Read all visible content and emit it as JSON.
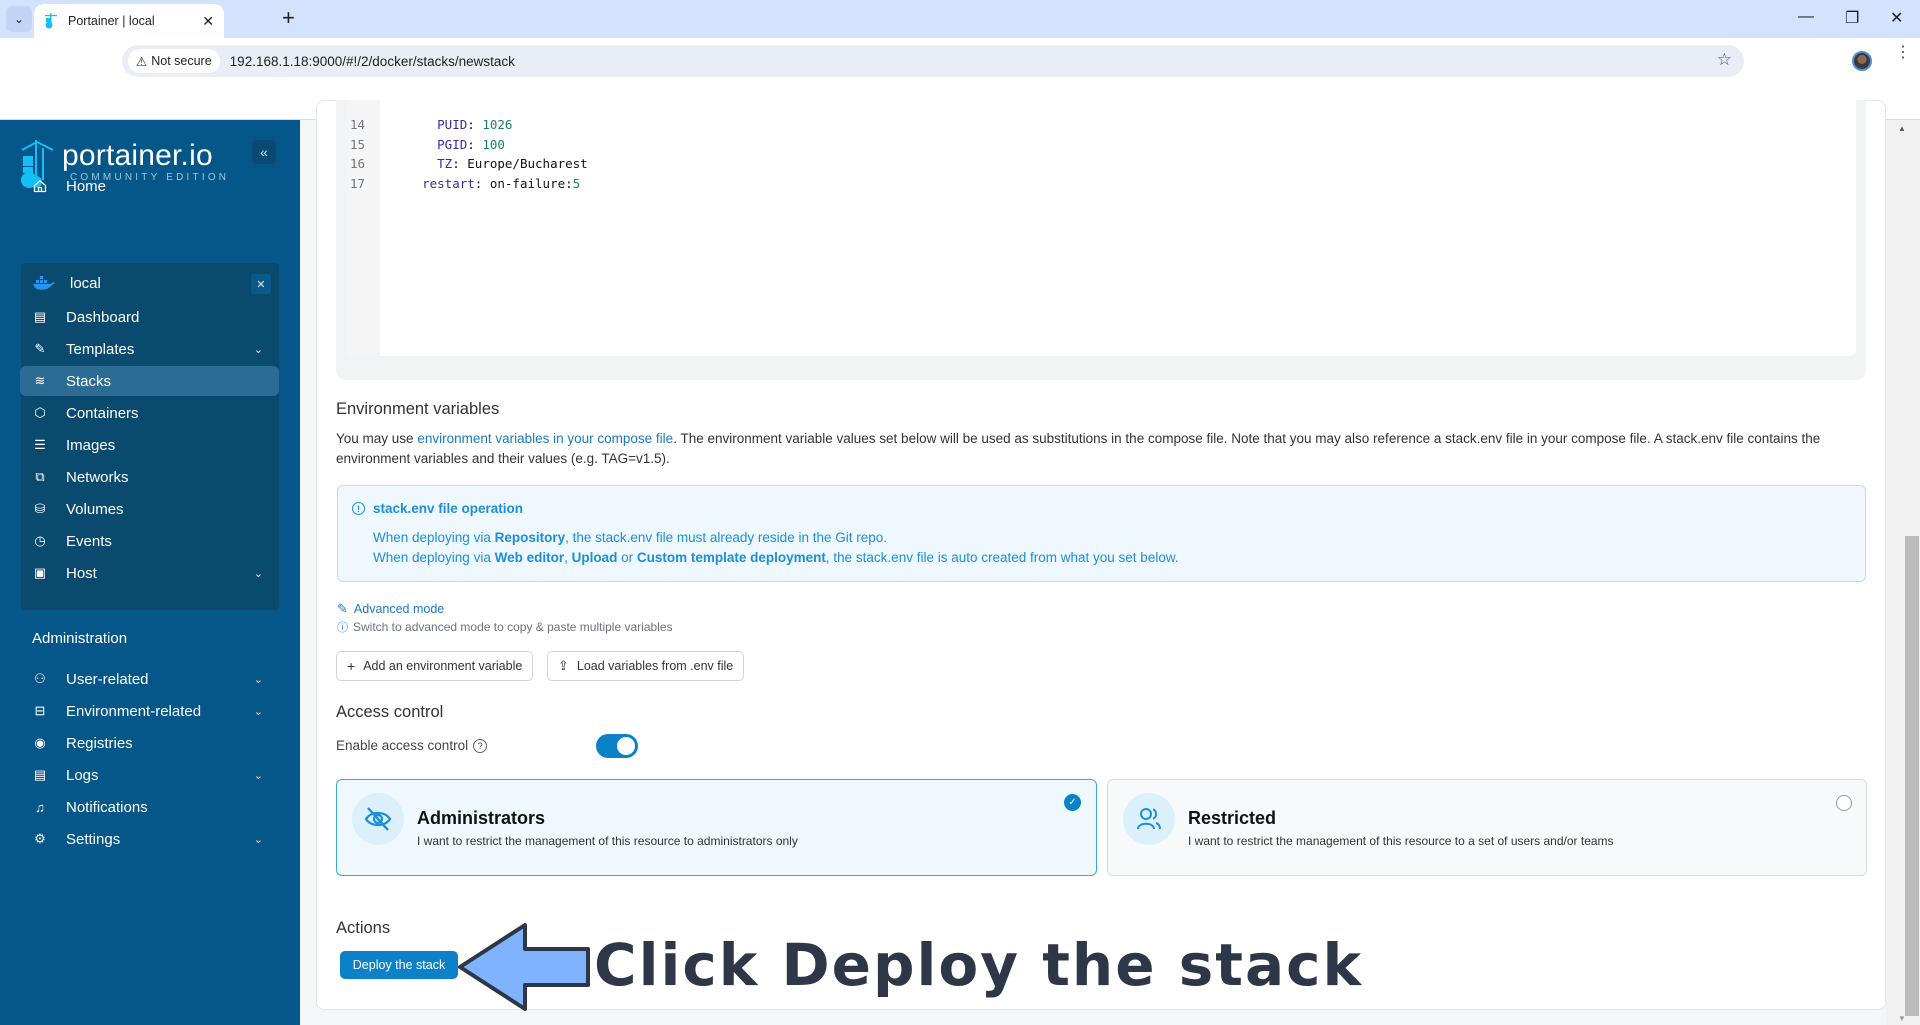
{
  "browser": {
    "tab_title": "Portainer | local",
    "not_secure_label": "Not secure",
    "url": "192.168.1.18:9000/#!/2/docker/stacks/newstack"
  },
  "sidebar": {
    "logo_main": "portainer.io",
    "logo_sub": "COMMUNITY EDITION",
    "home": "Home",
    "environment": {
      "name": "local",
      "items": [
        {
          "label": "Dashboard",
          "icon": "dashboard-icon",
          "chevron": false
        },
        {
          "label": "Templates",
          "icon": "edit-icon",
          "chevron": true
        },
        {
          "label": "Stacks",
          "icon": "layers-icon",
          "chevron": false,
          "active": true
        },
        {
          "label": "Containers",
          "icon": "box-icon",
          "chevron": false
        },
        {
          "label": "Images",
          "icon": "list-icon",
          "chevron": false
        },
        {
          "label": "Networks",
          "icon": "network-icon",
          "chevron": false
        },
        {
          "label": "Volumes",
          "icon": "database-icon",
          "chevron": false
        },
        {
          "label": "Events",
          "icon": "clock-icon",
          "chevron": false
        },
        {
          "label": "Host",
          "icon": "host-icon",
          "chevron": true
        }
      ]
    },
    "admin_heading": "Administration",
    "admin_items": [
      {
        "label": "User-related",
        "icon": "users-icon",
        "chevron": true
      },
      {
        "label": "Environment-related",
        "icon": "drive-icon",
        "chevron": true
      },
      {
        "label": "Registries",
        "icon": "radio-icon",
        "chevron": false
      },
      {
        "label": "Logs",
        "icon": "file-icon",
        "chevron": true
      },
      {
        "label": "Notifications",
        "icon": "bell-icon",
        "chevron": false
      },
      {
        "label": "Settings",
        "icon": "gear-icon",
        "chevron": true
      }
    ]
  },
  "editor": {
    "lines": [
      {
        "n": "14",
        "indent": "      ",
        "key": "PUID",
        "value": "1026",
        "value_type": "num"
      },
      {
        "n": "15",
        "indent": "      ",
        "key": "PGID",
        "value": "100",
        "value_type": "num"
      },
      {
        "n": "16",
        "indent": "      ",
        "key": "TZ",
        "value": "Europe/Bucharest",
        "value_type": "txt"
      },
      {
        "n": "17",
        "indent": "    ",
        "key": "restart",
        "value": "on-failure:",
        "value_suffix": "5",
        "value_type": "txt"
      }
    ]
  },
  "env_vars": {
    "heading": "Environment variables",
    "para_pre": "You may use ",
    "para_link": "environment variables in your compose file",
    "para_post": ". The environment variable values set below will be used as substitutions in the compose file. Note that you may also reference a stack.env file in your compose file. A stack.env file contains the environment variables and their values (e.g. TAG=v1.5).",
    "info": {
      "title": "stack.env file operation",
      "l1_pre": "When deploying via ",
      "l1_b1": "Repository",
      "l1_post": ", the stack.env file must already reside in the Git repo.",
      "l2_pre": "When deploying via ",
      "l2_b1": "Web editor",
      "l2_mid1": ", ",
      "l2_b2": "Upload",
      "l2_mid2": " or ",
      "l2_b3": "Custom template deployment",
      "l2_post": ", the stack.env file is auto created from what you set below."
    },
    "advanced_mode": "Advanced mode",
    "advanced_hint": "Switch to advanced mode to copy & paste multiple variables",
    "add_button": "Add an environment variable",
    "load_button": "Load variables from .env file"
  },
  "access_control": {
    "heading": "Access control",
    "enable_label": "Enable access control",
    "enabled": true,
    "options": [
      {
        "title": "Administrators",
        "desc": "I want to restrict the management of this resource to administrators only",
        "selected": true
      },
      {
        "title": "Restricted",
        "desc": "I want to restrict the management of this resource to a set of users and/or teams",
        "selected": false
      }
    ]
  },
  "actions": {
    "heading": "Actions",
    "deploy_button": "Deploy the stack"
  },
  "annotation": {
    "text": "Click Deploy the stack",
    "arrow_color": "#7fb2ff"
  },
  "colors": {
    "sidebar_bg": "#065789",
    "accent": "#0b82c7",
    "info_text": "#1c8fd6"
  }
}
